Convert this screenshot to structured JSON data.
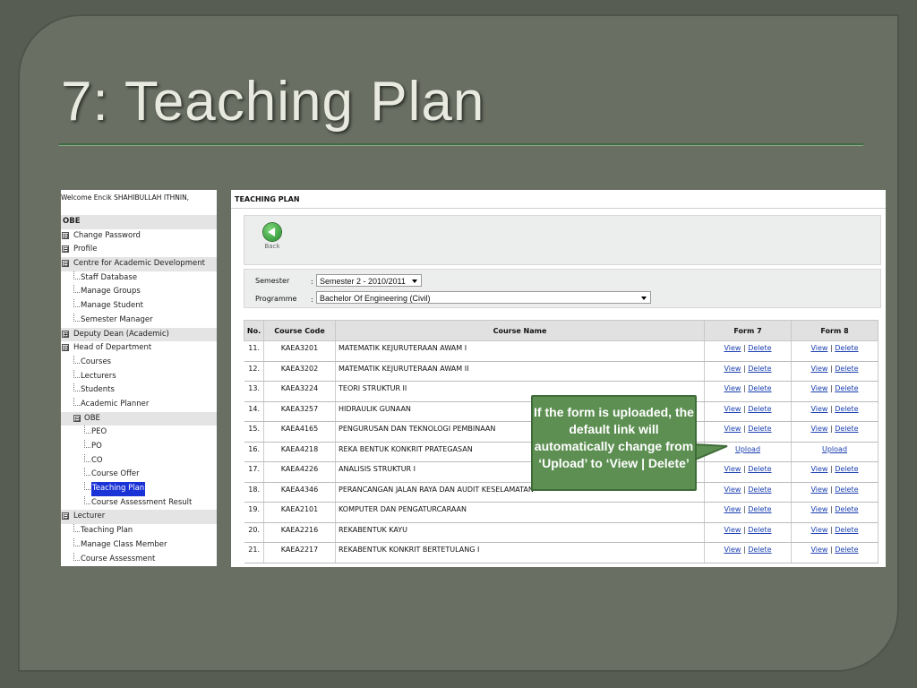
{
  "slide": {
    "title": "7: Teaching Plan"
  },
  "left_panel": {
    "welcome": "Welcome Encik SHAHIBULLAH ITHNIN,",
    "section_header": "OBE",
    "items": [
      {
        "label": "Change Password",
        "toggle": "⊟"
      },
      {
        "label": "Profile",
        "toggle": "⊟"
      },
      {
        "label": "Centre for Academic Development",
        "toggle": "⊟"
      },
      {
        "label": "Staff Database"
      },
      {
        "label": "Manage Groups"
      },
      {
        "label": "Manage Student"
      },
      {
        "label": "Semester Manager"
      },
      {
        "label": "Deputy Dean (Academic)",
        "toggle": "⊞"
      },
      {
        "label": "Head of Department",
        "toggle": "⊟"
      },
      {
        "label": "Courses"
      },
      {
        "label": "Lecturers"
      },
      {
        "label": "Students"
      },
      {
        "label": "Academic Planner"
      },
      {
        "label": "OBE",
        "toggle": "⊟"
      },
      {
        "label": "PEO"
      },
      {
        "label": "PO"
      },
      {
        "label": "CO"
      },
      {
        "label": "Course Offer"
      },
      {
        "label": "Teaching Plan",
        "selected": true
      },
      {
        "label": "Course Assessment Result"
      },
      {
        "label": "Lecturer",
        "toggle": "⊟"
      },
      {
        "label": "Teaching Plan"
      },
      {
        "label": "Manage Class Member"
      },
      {
        "label": "Course Assessment"
      }
    ]
  },
  "main": {
    "title": "TEACHING PLAN",
    "back_label": "Back",
    "filters": {
      "semester_label": "Semester",
      "semester_value": "Semester 2 - 2010/2011",
      "programme_label": "Programme",
      "programme_value": "Bachelor Of Engineering (Civil)",
      "colon": ":"
    },
    "table": {
      "headers": [
        "No.",
        "Course Code",
        "Course Name",
        "Form 7",
        "Form 8"
      ],
      "view_label": "View",
      "delete_label": "Delete",
      "upload_label": "Upload",
      "separator": "|",
      "rows": [
        {
          "no": "11.",
          "code": "KAEA3201",
          "name": "MATEMATIK KEJURUTERAAN AWAM I",
          "uploaded": true
        },
        {
          "no": "12.",
          "code": "KAEA3202",
          "name": "MATEMATIK KEJURUTERAAN AWAM II",
          "uploaded": true
        },
        {
          "no": "13.",
          "code": "KAEA3224",
          "name": "TEORI STRUKTUR II",
          "uploaded": true
        },
        {
          "no": "14.",
          "code": "KAEA3257",
          "name": "HIDRAULIK GUNAAN",
          "uploaded": true
        },
        {
          "no": "15.",
          "code": "KAEA4165",
          "name": "PENGURUSAN DAN TEKNOLOGI PEMBINAAN",
          "uploaded": true
        },
        {
          "no": "16.",
          "code": "KAEA4218",
          "name": "REKA BENTUK KONKRIT PRATEGASAN",
          "uploaded": false
        },
        {
          "no": "17.",
          "code": "KAEA4226",
          "name": "ANALISIS STRUKTUR I",
          "uploaded": true
        },
        {
          "no": "18.",
          "code": "KAEA4346",
          "name": "PERANCANGAN JALAN RAYA DAN AUDIT KESELAMATAN",
          "uploaded": true
        },
        {
          "no": "19.",
          "code": "KAEA2101",
          "name": "KOMPUTER DAN PENGATURCARAAN",
          "uploaded": true
        },
        {
          "no": "20.",
          "code": "KAEA2216",
          "name": "REKABENTUK KAYU",
          "uploaded": true
        },
        {
          "no": "21.",
          "code": "KAEA2217",
          "name": "REKABENTUK KONKRIT BERTETULANG I",
          "uploaded": true
        }
      ]
    }
  },
  "callout": {
    "text": "If the form is uploaded, the default link will automatically change from ‘Upload’ to ‘View | Delete’",
    "color": "#5d8f52"
  }
}
